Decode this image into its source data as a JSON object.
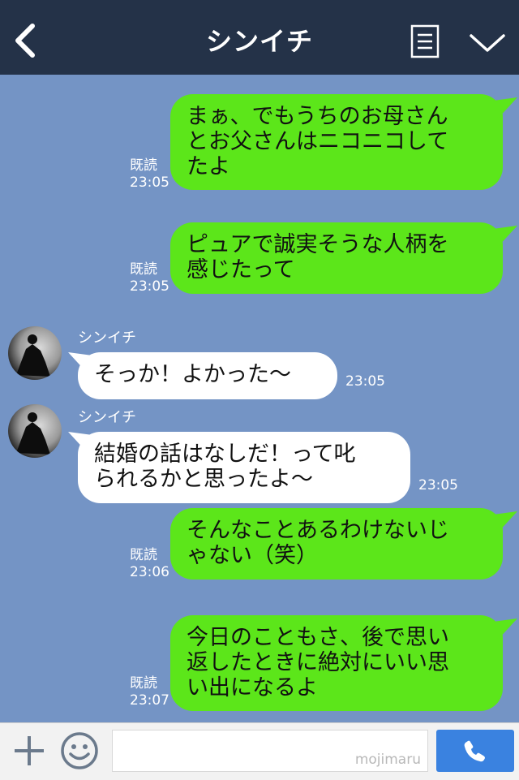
{
  "header": {
    "title": "シンイチ"
  },
  "messages": [
    {
      "side": "me",
      "text": "まぁ、でもうちのお母さん\nとお父さんはニコニコして\nたよ",
      "read": "既読",
      "time": "23:05"
    },
    {
      "side": "me",
      "text": "ピュアで誠実そうな人柄を\n感じたって",
      "read": "既読",
      "time": "23:05"
    },
    {
      "side": "them",
      "sender": "シンイチ",
      "text": "そっか！よかった〜",
      "time": "23:05"
    },
    {
      "side": "them",
      "sender": "シンイチ",
      "text": "結婚の話はなしだ！って叱\nられるかと思ったよ〜",
      "time": "23:05"
    },
    {
      "side": "me",
      "text": "そんなことあるわけないじ\nゃない（笑）",
      "read": "既読",
      "time": "23:06"
    },
    {
      "side": "me",
      "text": "今日のこともさ、後で思い\n返したときに絶対にいい思\nい出になるよ",
      "read": "既読",
      "time": "23:07"
    }
  ],
  "footer": {
    "watermark": "mojimaru"
  },
  "icons": [
    "back-chevron-icon",
    "menu-list-icon",
    "chevron-down-icon",
    "plus-icon",
    "smile-icon",
    "phone-icon"
  ],
  "colors": {
    "header": "#243248",
    "chat_bg": "#7494c5",
    "my_bubble": "#5ce61a",
    "their_bubble": "#ffffff",
    "call_button": "#3a82e0"
  }
}
